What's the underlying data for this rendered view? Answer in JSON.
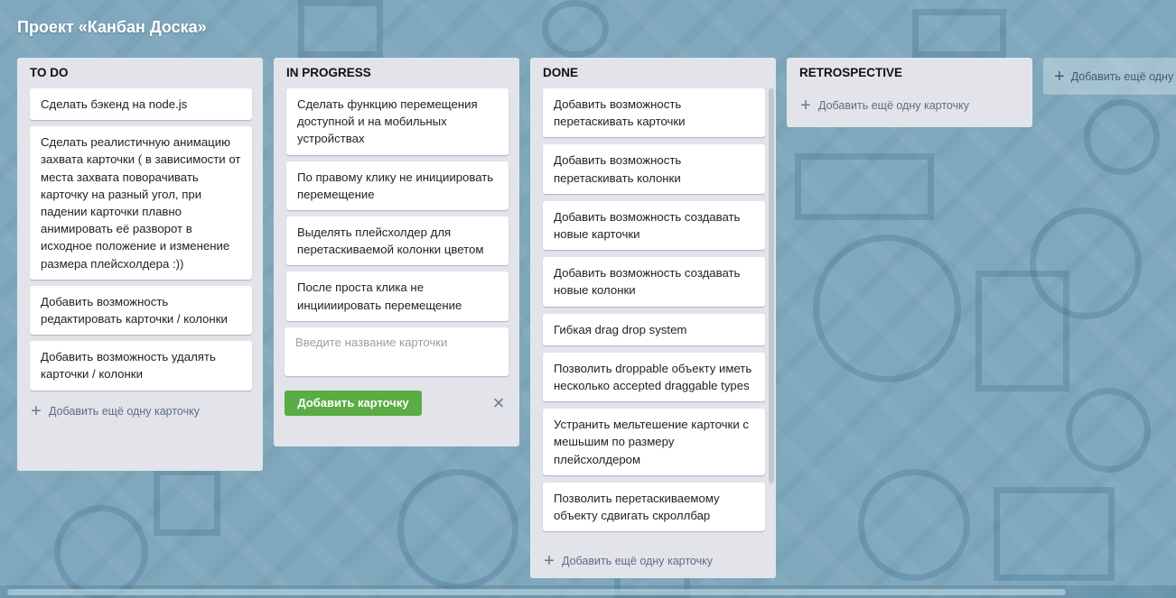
{
  "board": {
    "title": "Проект «Канбан Доска»"
  },
  "columns": [
    {
      "title": "TO DO",
      "cards": [
        "Сделать бэкенд на node.js",
        "Сделать реалистичную анимацию захвата карточки ( в зависимости от места захвата поворачивать карточку на разный угол, при падении карточки плавно анимировать её разворот в исходное положение и изменение размера плейсхолдера :))",
        "Добавить возможность редактировать карточки / колонки",
        "Добавить возможность удалять карточки / колонки"
      ],
      "add_card_label": "Добавить ещё одну карточку"
    },
    {
      "title": "IN PROGRESS",
      "cards": [
        "Сделать функцию перемещения доступной и на мобильных устройствах",
        "По правому клику не инициировать перемещение",
        "Выделять плейсхолдер для перетаскиваемой колонки цветом",
        "После проста клика не инциииировать перемещение"
      ],
      "composer": {
        "placeholder": "Введите название карточки",
        "submit_label": "Добавить карточку",
        "close_icon": "×"
      }
    },
    {
      "title": "DONE",
      "cards": [
        "Добавить возможность перетаскивать карточки",
        "Добавить возможность перетаскивать колонки",
        "Добавить возможность создавать новые карточки",
        "Добавить возможность создавать новые колонки",
        "Гибкая drag drop system",
        "Позволить droppable объекту иметь несколько accepted draggable types",
        "Устранить мельтешение карточки с мешьшим по размеру плейсхолдером",
        "Позволить перетаскиваемому объекту сдвигать скроллбар"
      ],
      "add_card_label": "Добавить ещё одну карточку"
    },
    {
      "title": "RETROSPECTIVE",
      "cards": [],
      "add_card_label": "Добавить ещё одну карточку"
    }
  ],
  "add_column_label": "Добавить ещё одну колонку",
  "icons": {
    "plus": "+",
    "close": "×"
  },
  "colors": {
    "background": "#7fa8bd",
    "column_bg": "#e2e4ea",
    "card_bg": "#ffffff",
    "accent_green": "#5aac44"
  }
}
